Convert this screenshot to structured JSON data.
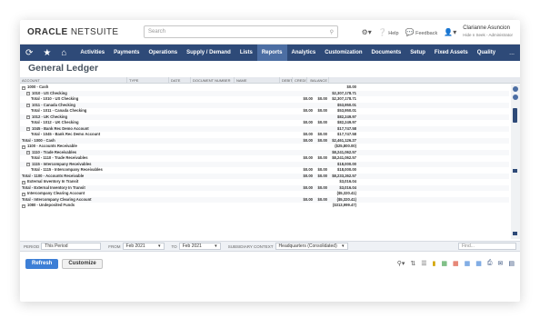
{
  "app": {
    "logo_oracle": "ORACLE",
    "logo_netsuite": "NETSUITE",
    "search_placeholder": "Search",
    "help_label": "Help",
    "feedback_label": "Feedback",
    "user_name": "Clarianne Asuncion",
    "user_role": "Hide n Seek - Administrator"
  },
  "nav": {
    "items": [
      "Activities",
      "Payments",
      "Operations",
      "Supply / Demand",
      "Lists",
      "Reports",
      "Analytics",
      "Customization",
      "Documents",
      "Setup",
      "Fixed Assets",
      "Quality"
    ],
    "active": "Reports",
    "more_label": "..."
  },
  "page": {
    "title": "General Ledger"
  },
  "table": {
    "headers": {
      "account": "ACCOUNT",
      "type": "TYPE",
      "date": "DATE",
      "docnum": "DOCUMENT NUMBER",
      "name": "NAME",
      "debit": "DEBIT",
      "credit": "CREDIT",
      "balance": "BALANCE"
    },
    "rows": [
      {
        "acct": "1000 - Cash",
        "deb": "",
        "cre": "",
        "bal": "$0.00",
        "lvl": 1,
        "toggle": true,
        "bold": true
      },
      {
        "acct": "1010 - US Checking",
        "deb": "",
        "cre": "",
        "bal": "$2,307,178.71",
        "lvl": 2,
        "toggle": true,
        "bold": true
      },
      {
        "acct": "Total - 1010 - US Checking",
        "deb": "$0.00",
        "cre": "$0.00",
        "bal": "$2,307,178.71",
        "lvl": 3,
        "toggle": false,
        "bold": true
      },
      {
        "acct": "1011 - Canada Checking",
        "deb": "",
        "cre": "",
        "bal": "$53,950.01",
        "lvl": 2,
        "toggle": true,
        "bold": true
      },
      {
        "acct": "Total - 1011 - Canada Checking",
        "deb": "$0.00",
        "cre": "$0.00",
        "bal": "$53,950.01",
        "lvl": 3,
        "toggle": false,
        "bold": true
      },
      {
        "acct": "1012 - UK Checking",
        "deb": "",
        "cre": "",
        "bal": "$82,249.97",
        "lvl": 2,
        "toggle": true,
        "bold": true
      },
      {
        "acct": "Total - 1012 - UK Checking",
        "deb": "$0.00",
        "cre": "$0.00",
        "bal": "$82,249.97",
        "lvl": 3,
        "toggle": false,
        "bold": true
      },
      {
        "acct": "1045 - Bank Rec Demo Account",
        "deb": "",
        "cre": "",
        "bal": "$17,747.58",
        "lvl": 2,
        "toggle": true,
        "bold": true
      },
      {
        "acct": "Total - 1045 - Bank Rec Demo Account",
        "deb": "$0.00",
        "cre": "$0.00",
        "bal": "$17,747.58",
        "lvl": 3,
        "toggle": false,
        "bold": true
      },
      {
        "acct": "Total - 1000 - Cash",
        "deb": "$0.00",
        "cre": "$0.00",
        "bal": "$2,461,126.27",
        "lvl": 1,
        "toggle": false,
        "bold": true
      },
      {
        "acct": "1100 - Accounts Receivable",
        "deb": "",
        "cre": "",
        "bal": "($25,800.00)",
        "lvl": 1,
        "toggle": true,
        "bold": true
      },
      {
        "acct": "1110 - Trade Receivables",
        "deb": "",
        "cre": "",
        "bal": "$8,241,062.57",
        "lvl": 2,
        "toggle": true,
        "bold": true
      },
      {
        "acct": "Total - 1110 - Trade Receivables",
        "deb": "$0.00",
        "cre": "$0.00",
        "bal": "$8,241,062.57",
        "lvl": 3,
        "toggle": false,
        "bold": true
      },
      {
        "acct": "1115 - Intercompany Receivables",
        "deb": "",
        "cre": "",
        "bal": "$18,000.00",
        "lvl": 2,
        "toggle": true,
        "bold": true
      },
      {
        "acct": "Total - 1115 - Intercompany Receivables",
        "deb": "$0.00",
        "cre": "$0.00",
        "bal": "$18,000.00",
        "lvl": 3,
        "toggle": false,
        "bold": true
      },
      {
        "acct": "Total - 1100 - Accounts Receivable",
        "deb": "$0.00",
        "cre": "$0.00",
        "bal": "$8,233,262.57",
        "lvl": 1,
        "toggle": false,
        "bold": true
      },
      {
        "acct": "External Inventory In Transit",
        "deb": "",
        "cre": "",
        "bal": "$3,016.04",
        "lvl": 1,
        "toggle": true,
        "bold": true
      },
      {
        "acct": "Total - External Inventory In Transit",
        "deb": "$0.00",
        "cre": "$0.00",
        "bal": "$3,016.04",
        "lvl": 1,
        "toggle": false,
        "bold": true
      },
      {
        "acct": "Intercompany Clearing Account",
        "deb": "",
        "cre": "",
        "bal": "($5,320.41)",
        "lvl": 1,
        "toggle": true,
        "bold": true
      },
      {
        "acct": "Total - Intercompany Clearing Account",
        "deb": "$0.00",
        "cre": "$0.00",
        "bal": "($5,320.41)",
        "lvl": 1,
        "toggle": false,
        "bold": true
      },
      {
        "acct": "1080 - Undeposited Funds",
        "deb": "",
        "cre": "",
        "bal": "($313,999.47)",
        "lvl": 1,
        "toggle": true,
        "bold": true
      }
    ]
  },
  "filters": {
    "period_label": "PERIOD",
    "period_value": "This Period",
    "from_label": "FROM",
    "from_value": "Feb 2021",
    "to_label": "TO",
    "to_value": "Feb 2021",
    "subsidiary_label": "SUBSIDIARY CONTEXT",
    "subsidiary_value": "Headquarters (Consolidated)",
    "find_placeholder": "Find..."
  },
  "actions": {
    "refresh_label": "Refresh",
    "customize_label": "Customize"
  }
}
